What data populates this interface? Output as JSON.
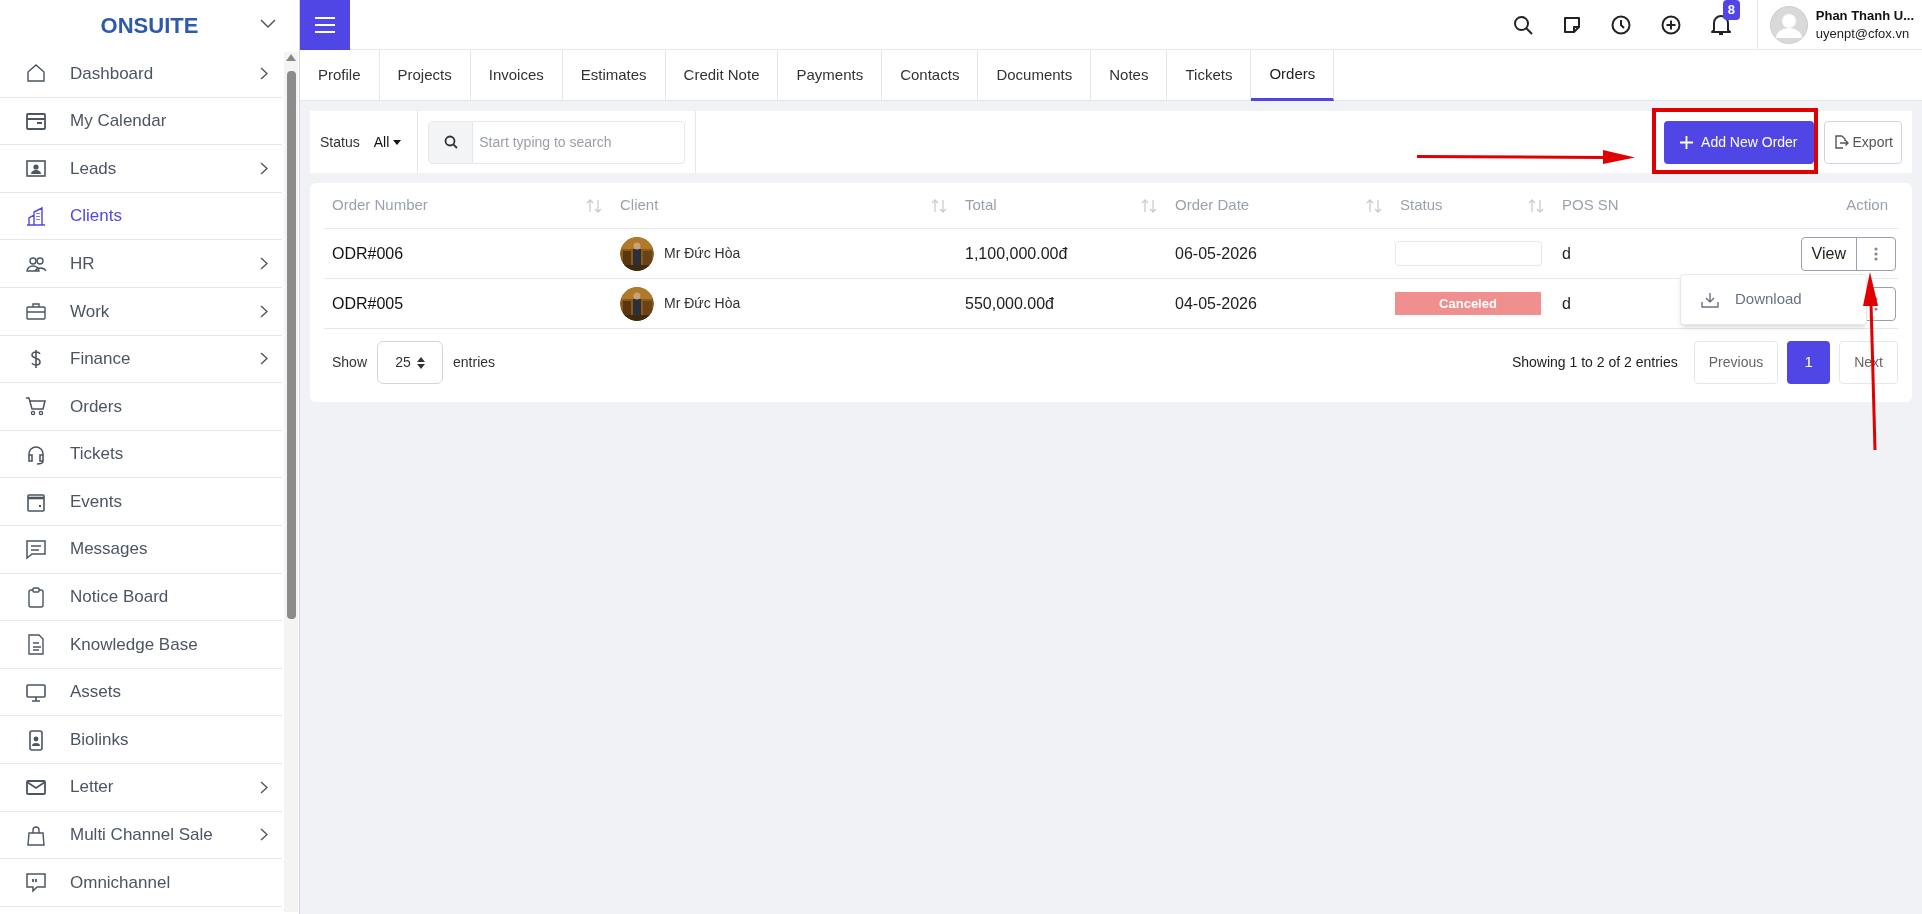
{
  "brand": {
    "title": "ONSUITE"
  },
  "sidebar": {
    "items": [
      {
        "label": "Dashboard",
        "selected": false,
        "expandable": true
      },
      {
        "label": "My Calendar",
        "selected": false,
        "expandable": false
      },
      {
        "label": "Leads",
        "selected": false,
        "expandable": true
      },
      {
        "label": "Clients",
        "selected": true,
        "expandable": false
      },
      {
        "label": "HR",
        "selected": false,
        "expandable": true
      },
      {
        "label": "Work",
        "selected": false,
        "expandable": true
      },
      {
        "label": "Finance",
        "selected": false,
        "expandable": true
      },
      {
        "label": "Orders",
        "selected": false,
        "expandable": false
      },
      {
        "label": "Tickets",
        "selected": false,
        "expandable": false
      },
      {
        "label": "Events",
        "selected": false,
        "expandable": false
      },
      {
        "label": "Messages",
        "selected": false,
        "expandable": false
      },
      {
        "label": "Notice Board",
        "selected": false,
        "expandable": false
      },
      {
        "label": "Knowledge Base",
        "selected": false,
        "expandable": false
      },
      {
        "label": "Assets",
        "selected": false,
        "expandable": false
      },
      {
        "label": "Biolinks",
        "selected": false,
        "expandable": false
      },
      {
        "label": "Letter",
        "selected": false,
        "expandable": true
      },
      {
        "label": "Multi Channel Sale",
        "selected": false,
        "expandable": true
      },
      {
        "label": "Omnichannel",
        "selected": false,
        "expandable": false
      }
    ]
  },
  "header": {
    "notification_count": "8",
    "user": {
      "name": "Phan Thanh U...",
      "email": "uyenpt@cfox.vn"
    }
  },
  "tabs": [
    {
      "label": "Profile",
      "selected": false
    },
    {
      "label": "Projects",
      "selected": false
    },
    {
      "label": "Invoices",
      "selected": false
    },
    {
      "label": "Estimates",
      "selected": false
    },
    {
      "label": "Credit Note",
      "selected": false
    },
    {
      "label": "Payments",
      "selected": false
    },
    {
      "label": "Contacts",
      "selected": false
    },
    {
      "label": "Documents",
      "selected": false
    },
    {
      "label": "Notes",
      "selected": false
    },
    {
      "label": "Tickets",
      "selected": false
    },
    {
      "label": "Orders",
      "selected": true
    }
  ],
  "filters": {
    "status_label": "Status",
    "status_value": "All",
    "search": {
      "placeholder": "Start typing to search"
    }
  },
  "actions": {
    "add": "Add New Order",
    "export": "Export"
  },
  "table": {
    "columns": [
      {
        "label": "Order Number",
        "sortable": true
      },
      {
        "label": "Client",
        "sortable": true
      },
      {
        "label": "Total",
        "sortable": true
      },
      {
        "label": "Order Date",
        "sortable": true
      },
      {
        "label": "Status",
        "sortable": true
      },
      {
        "label": "POS SN",
        "sortable": false
      },
      {
        "label": "Action",
        "sortable": false
      }
    ],
    "rows": [
      {
        "order_number": "ODR#006",
        "client": "Mr Đức Hòa",
        "total": "1,100,000.00đ",
        "order_date": "06-05-2026",
        "status": {
          "kind": "empty"
        },
        "pos_sn": "d",
        "action": {
          "view": "View"
        }
      },
      {
        "order_number": "ODR#005",
        "client": "Mr Đức Hòa",
        "total": "550,000.00đ",
        "order_date": "04-05-2026",
        "status": {
          "kind": "badge",
          "text": "Canceled"
        },
        "pos_sn": "d"
      }
    ]
  },
  "dropdown": {
    "items": [
      "Download"
    ]
  },
  "footer": {
    "show": "Show",
    "page_size": "25",
    "entries": "entries",
    "info": "Showing 1 to 2 of 2 entries",
    "previous": "Previous",
    "pages": [
      {
        "label": "1",
        "selected": true
      }
    ],
    "next": "Next"
  },
  "annotations": [
    {
      "kind": "frame"
    },
    {
      "kind": "arrow-right"
    },
    {
      "kind": "arrow-up"
    }
  ]
}
